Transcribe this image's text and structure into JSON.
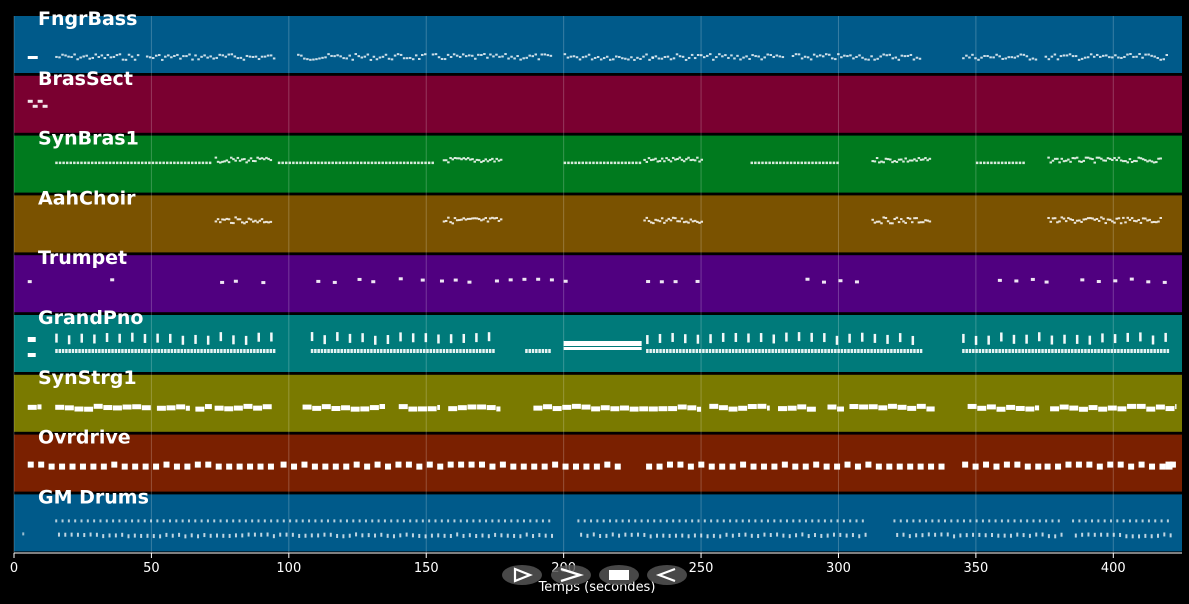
{
  "timeline": {
    "axis_label": "Temps (secondes)",
    "x_range": [
      0,
      425
    ],
    "ticks": [
      0,
      50,
      100,
      150,
      200,
      250,
      300,
      350,
      400
    ]
  },
  "tracks": [
    {
      "name": "FngrBass",
      "color": "#005a8a",
      "kind": "dense"
    },
    {
      "name": "BrasSect",
      "color": "#7a0030",
      "kind": "tiny"
    },
    {
      "name": "SynBras1",
      "color": "#007a1e",
      "kind": "phrases"
    },
    {
      "name": "AahChoir",
      "color": "#7a5200",
      "kind": "clusters"
    },
    {
      "name": "Trumpet",
      "color": "#500080",
      "kind": "sparse"
    },
    {
      "name": "GrandPno",
      "color": "#007a7a",
      "kind": "piano"
    },
    {
      "name": "SynStrg1",
      "color": "#7a7a00",
      "kind": "blocks"
    },
    {
      "name": "Ovrdrive",
      "color": "#7a2000",
      "kind": "squares"
    },
    {
      "name": "GM Drums",
      "color": "#005a8a",
      "kind": "drums"
    }
  ],
  "transport": [
    {
      "id": "play",
      "icon": "play-icon"
    },
    {
      "id": "forward",
      "icon": "forward-icon"
    },
    {
      "id": "stop",
      "icon": "stop-icon"
    },
    {
      "id": "back",
      "icon": "back-icon"
    }
  ]
}
